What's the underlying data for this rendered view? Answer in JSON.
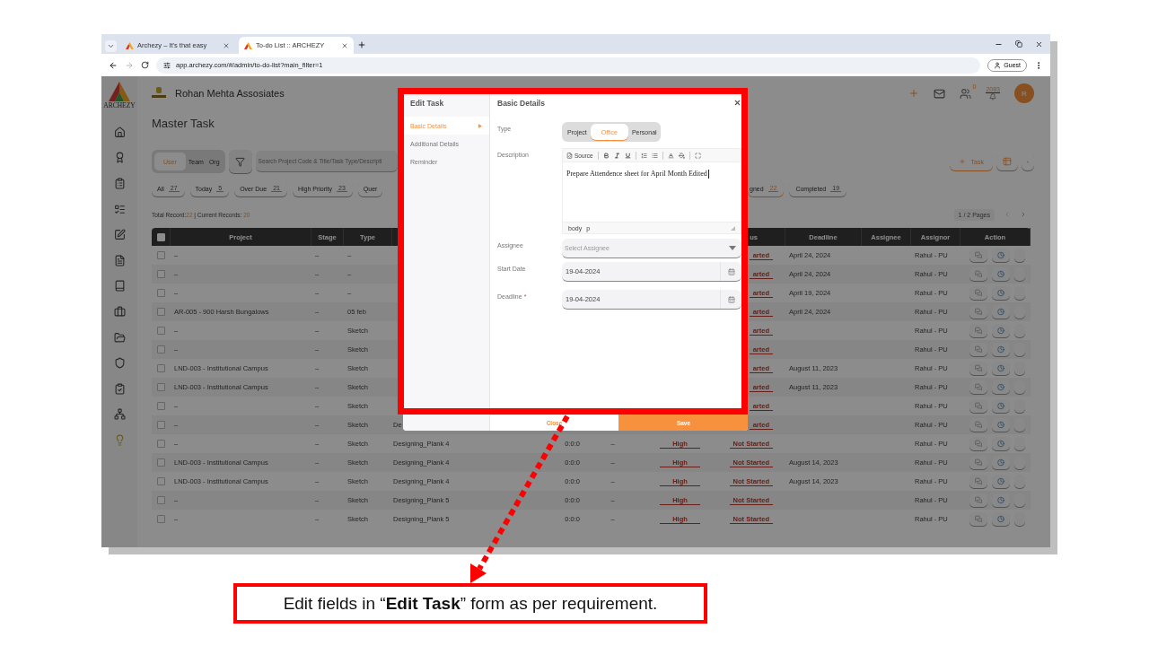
{
  "browser": {
    "tabs": [
      {
        "title": "Archezy – It's that easy",
        "selected": false
      },
      {
        "title": "To-do List :: ARCHEZY",
        "selected": true
      }
    ],
    "url": "app.archezy.com/#/admin/to-do-list?main_filter=1",
    "profile": "Guest"
  },
  "app": {
    "logo_text": "ARCHEZY",
    "company": "Rohan Mehta Assosiates",
    "notification_count": "0",
    "points": "2083",
    "avatar": "R",
    "page_title": "Master Task",
    "scope": [
      {
        "label": "User",
        "selected": true
      },
      {
        "label": "Team",
        "selected": false
      },
      {
        "label": "Org",
        "selected": false
      }
    ],
    "search": {
      "placeholder": "Search Project Code & Title/Task Type/Descripti"
    },
    "add_task": "Task",
    "chips_left": [
      {
        "label": "All",
        "count": "27",
        "selected": false
      },
      {
        "label": "Today",
        "count": "5",
        "selected": false
      },
      {
        "label": "Over Due",
        "count": "21",
        "selected": false
      },
      {
        "label": "High Priority",
        "count": "23",
        "selected": false
      },
      {
        "label": "Quer",
        "selected": false
      }
    ],
    "chips_right": [
      {
        "label": "gned",
        "count": "22",
        "selected": true
      },
      {
        "label": "Completed",
        "count": "19",
        "selected": false
      }
    ],
    "totals": {
      "total_label": "Total Record:",
      "total": "22",
      "current_label": " | Current Records: ",
      "current": "20"
    },
    "pagination": "1 / 2 Pages",
    "table": {
      "select_all_checked": false,
      "columns": [
        "Project",
        "Stage",
        "Type",
        "us",
        "Deadline",
        "Assignee",
        "Assignor",
        "Action"
      ],
      "rows": [
        {
          "checked": false,
          "project": "–",
          "stage": "–",
          "type": "–",
          "status": "arted",
          "deadline": "April 24, 2024",
          "assignor": "Rahul - PU"
        },
        {
          "checked": false,
          "project": "–",
          "stage": "–",
          "type": "–",
          "status": "arted",
          "deadline": "April 24, 2024",
          "assignor": "Rahul - PU"
        },
        {
          "checked": false,
          "project": "–",
          "stage": "–",
          "type": "–",
          "status": "arted",
          "deadline": "April 19, 2024",
          "assignor": "Rahul - PU"
        },
        {
          "checked": false,
          "project": "AR-005 - 900 Harsh Bungalows",
          "stage": "–",
          "type": "05 feb",
          "status": "arted",
          "deadline": "April 24, 2024",
          "assignor": "Rahul - PU"
        },
        {
          "checked": false,
          "project": "–",
          "stage": "–",
          "type": "Sketch",
          "status": "arted",
          "assignor": "Rahul - PU"
        },
        {
          "checked": false,
          "project": "–",
          "stage": "–",
          "type": "Sketch",
          "status": "arted",
          "assignor": "Rahul - PU"
        },
        {
          "checked": false,
          "project": "LND-003 - Institutional Campus",
          "stage": "–",
          "type": "Sketch",
          "status": "arted",
          "deadline": "August 11, 2023",
          "assignor": "Rahul - PU"
        },
        {
          "checked": false,
          "project": "LND-003 - Institutional Campus",
          "stage": "–",
          "type": "Sketch",
          "status": "arted",
          "deadline": "August 11, 2023",
          "assignor": "Rahul - PU"
        },
        {
          "checked": false,
          "project": "–",
          "stage": "–",
          "type": "Sketch",
          "status": "arted",
          "assignor": "Rahul - PU"
        },
        {
          "checked": false,
          "project": "–",
          "stage": "–",
          "type": "Sketch",
          "task": "De",
          "status": "arted",
          "assignor": "Rahul - PU"
        },
        {
          "checked": false,
          "project": "–",
          "stage": "–",
          "type": "Sketch",
          "task": "Designing_Plank 4",
          "duration": "0:0:0",
          "column_7": "–",
          "priority": "High",
          "status": "Not Started",
          "assignor": "Rahul - PU"
        },
        {
          "checked": false,
          "project": "LND-003 - Institutional Campus",
          "stage": "–",
          "type": "Sketch",
          "task": "Designing_Plank 4",
          "duration": "0:0:0",
          "column_7": "–",
          "priority": "High",
          "status": "Not Started",
          "deadline": "August 14, 2023",
          "assignor": "Rahul - PU"
        },
        {
          "checked": false,
          "project": "LND-003 - Institutional Campus",
          "stage": "–",
          "type": "Sketch",
          "task": "Designing_Plank 4",
          "duration": "0:0:0",
          "column_7": "–",
          "priority": "High",
          "status": "Not Started",
          "deadline": "August 14, 2023",
          "assignor": "Rahul - PU"
        },
        {
          "checked": false,
          "project": "–",
          "stage": "–",
          "type": "Sketch",
          "task": "Designing_Plank 5",
          "duration": "0:0:0",
          "column_7": "–",
          "priority": "High",
          "status": "Not Started",
          "assignor": "Rahul - PU"
        },
        {
          "checked": false,
          "project": "–",
          "stage": "–",
          "type": "Sketch",
          "task": "Designing_Plank 5",
          "duration": "0:0:0",
          "column_7": "–",
          "priority": "High",
          "status": "Not Started",
          "assignor": "Rahul - PU"
        }
      ]
    }
  },
  "modal": {
    "title": "Edit Task",
    "sections": [
      {
        "label": "Basic Details",
        "selected": true
      },
      {
        "label": "Additional Details",
        "selected": false
      },
      {
        "label": "Reminder",
        "selected": false
      }
    ],
    "heading": "Basic Details",
    "fields": [
      {
        "kind": "segmented",
        "label": "Type",
        "options": [
          {
            "label": "Project",
            "selected": false
          },
          {
            "label": "Office",
            "selected": true
          },
          {
            "label": "Personal",
            "selected": false
          }
        ]
      },
      {
        "kind": "editor",
        "label": "Description",
        "source_button": "Source",
        "value": "Prepare Attendence sheet for April Month Edited",
        "path": [
          "body",
          "p"
        ]
      },
      {
        "kind": "select",
        "label": "Assignee",
        "placeholder": "Select Assignee"
      },
      {
        "kind": "date",
        "label": "Start Date",
        "value": "19-04-2024"
      },
      {
        "kind": "date",
        "label": "Deadline",
        "required_mark": "*",
        "value": "19-04-2024"
      }
    ],
    "close": "Close",
    "save": "Save"
  },
  "callout": "Edit fields in “**Edit Task**” form as per requirement."
}
